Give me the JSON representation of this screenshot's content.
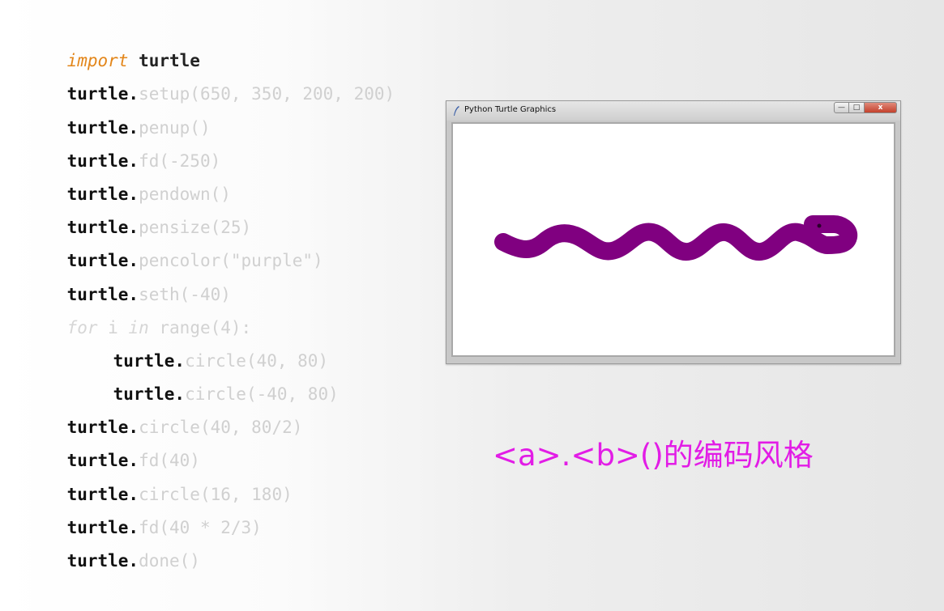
{
  "code": {
    "line1": {
      "kw": "import",
      "mod": " turtle"
    },
    "line2": {
      "obj": "turtle.",
      "call": "setup(650, 350, 200, 200)"
    },
    "line3": {
      "obj": "turtle.",
      "call": "penup()"
    },
    "line4": {
      "obj": "turtle.",
      "call": "fd(-250)"
    },
    "line5": {
      "obj": "turtle.",
      "call": "pendown()"
    },
    "line6": {
      "obj": "turtle.",
      "call": "pensize(25)"
    },
    "line7": {
      "obj": "turtle.",
      "call": "pencolor(\"purple\")"
    },
    "line8": {
      "obj": "turtle.",
      "call": "seth(-40)"
    },
    "line9": {
      "kw_for": "for",
      "mid": " i ",
      "kw_in": "in",
      "rest": " range(4):"
    },
    "line10": {
      "obj": "turtle.",
      "call": "circle(40, 80)"
    },
    "line11": {
      "obj": "turtle.",
      "call": "circle(-40, 80)"
    },
    "line12": {
      "obj": "turtle.",
      "call": "circle(40, 80/2)"
    },
    "line13": {
      "obj": "turtle.",
      "call": "fd(40)"
    },
    "line14": {
      "obj": "turtle.",
      "call": "circle(16, 180)"
    },
    "line15": {
      "obj": "turtle.",
      "call": "fd(40 * 2/3)"
    },
    "line16": {
      "obj": "turtle.",
      "call": "done()"
    }
  },
  "window": {
    "title": "Python Turtle Graphics",
    "icon": "feather-icon",
    "minimize": "—",
    "maximize": "□",
    "close": "x",
    "pen_color": "#800080"
  },
  "caption": "<a>.<b>()的编码风格",
  "colors": {
    "caption": "#e21ce6",
    "keyword": "#e3861a"
  }
}
